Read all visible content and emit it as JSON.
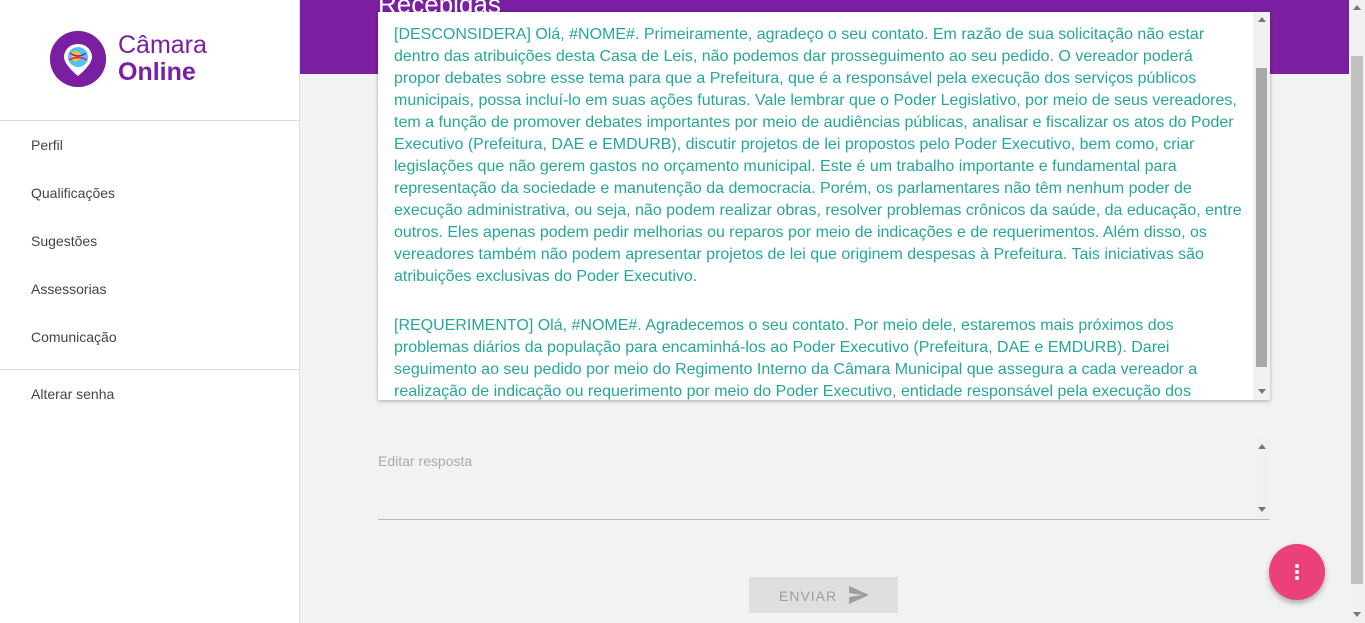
{
  "app": {
    "logo_line1": "Câmara",
    "logo_line2": "Online"
  },
  "sidebar": {
    "items": [
      {
        "label": "Perfil"
      },
      {
        "label": "Qualificações"
      },
      {
        "label": "Sugestões"
      },
      {
        "label": "Assessorias"
      },
      {
        "label": "Comunicação"
      }
    ],
    "secondary_items": [
      {
        "label": "Alterar senha"
      }
    ]
  },
  "header": {
    "title": "Recebidas"
  },
  "responses": [
    {
      "text": "[DESCONSIDERA] Olá, #NOME#. Primeiramente, agradeço o seu contato. Em razão de sua solicitação não estar dentro das atribuições desta Casa de Leis, não podemos dar prosseguimento ao seu pedido. O vereador poderá propor debates sobre esse tema para que a Prefeitura, que é a responsável pela execução dos serviços públicos municipais, possa incluí-lo em suas ações futuras. Vale lembrar que o Poder Legislativo, por meio de seus vereadores, tem a função de promover debates importantes por meio de audiências públicas, analisar e fiscalizar os atos do Poder Executivo (Prefeitura, DAE e EMDURB), discutir projetos de lei propostos pelo Poder Executivo, bem como, criar legislações que não gerem gastos no orçamento municipal. Este é um trabalho importante e fundamental para representação da sociedade e manutenção da democracia. Porém, os parlamentares não têm nenhum poder de execução administrativa, ou seja, não podem realizar obras, resolver problemas crônicos da saúde, da educação, entre outros. Eles apenas podem pedir melhorias ou reparos por meio de indicações e de requerimentos. Além disso, os vereadores também não podem apresentar projetos de lei que originem despesas à Prefeitura. Tais iniciativas são atribuições exclusivas do Poder Executivo."
    },
    {
      "text": "[REQUERIMENTO] Olá, #NOME#. Agradecemos o seu contato. Por meio dele, estaremos mais próximos dos problemas diários da população para encaminhá-los ao Poder Executivo (Prefeitura, DAE e EMDURB). Darei seguimento ao seu pedido por meio do Regimento Interno da Câmara Municipal que assegura a cada vereador a realização de indicação ou requerimento por meio do Poder Executivo, entidade responsável pela execução dos serviços públicos municipais."
    }
  ],
  "editor": {
    "placeholder": "Editar resposta",
    "value": ""
  },
  "actions": {
    "send_label": "ENVIAR"
  },
  "icons": {
    "logo": "map-pin-globe-icon",
    "send": "send-icon",
    "fab": "more-vert-icon"
  },
  "colors": {
    "primary": "#7b1fa2",
    "accent": "#ec407a",
    "text_teal": "#26a69a"
  }
}
